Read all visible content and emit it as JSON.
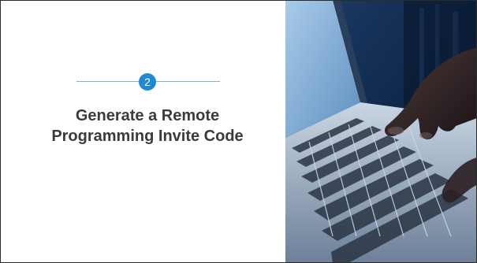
{
  "slide": {
    "step_number": "2",
    "title_line1": "Generate a Remote",
    "title_line2": "Programming Invite Code"
  },
  "colors": {
    "badge": "#1e8ad6",
    "divider": "#7fb0d6",
    "title_text": "#3b3b3b",
    "photo_base": "#0b1c33"
  },
  "photo": {
    "subject": "hands typing on laptop keyboard"
  }
}
